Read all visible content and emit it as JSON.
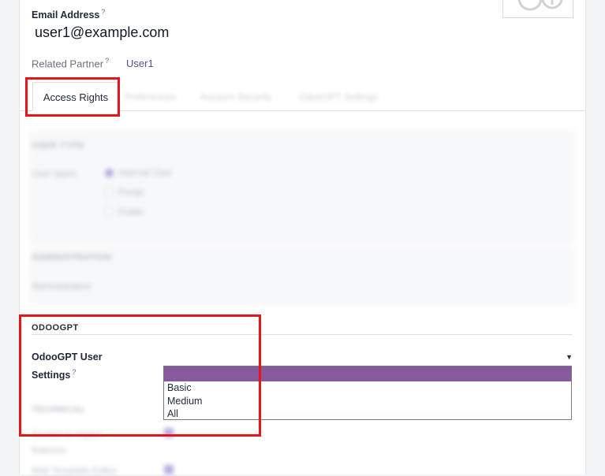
{
  "form": {
    "email_label": "Email Address",
    "email_help": "?",
    "email_value": "user1@example.com",
    "related_partner_label": "Related Partner",
    "related_partner_help": "?",
    "related_partner_value": "User1"
  },
  "tabs": [
    {
      "label": "Access Rights",
      "active": true
    },
    {
      "label": "Preferences"
    },
    {
      "label": "Account Security"
    },
    {
      "label": "OdooGPT Settings"
    }
  ],
  "sections": {
    "user_type": {
      "title": "USER TYPE",
      "field_label": "User types",
      "options": [
        "Internal User",
        "Portal",
        "Public"
      ],
      "selected": "Internal User"
    },
    "administration": {
      "title": "ADMINISTRATION",
      "field_label": "Administration"
    },
    "odoogpt": {
      "title": "ODOOGPT",
      "field_label_line1": "OdooGPT User",
      "field_label_line2": "Settings",
      "field_help": "?",
      "options": [
        "",
        "Basic",
        "Medium",
        "All"
      ],
      "selected_index": 0
    },
    "technical": {
      "title": "TECHNICAL",
      "field1_line1": "Access to export",
      "field1_line2": "features",
      "field2": "Mail Template Editor"
    }
  },
  "colors": {
    "accent": "#875a9e",
    "link": "#5b4b8a",
    "highlight_box": "#e3161b"
  }
}
